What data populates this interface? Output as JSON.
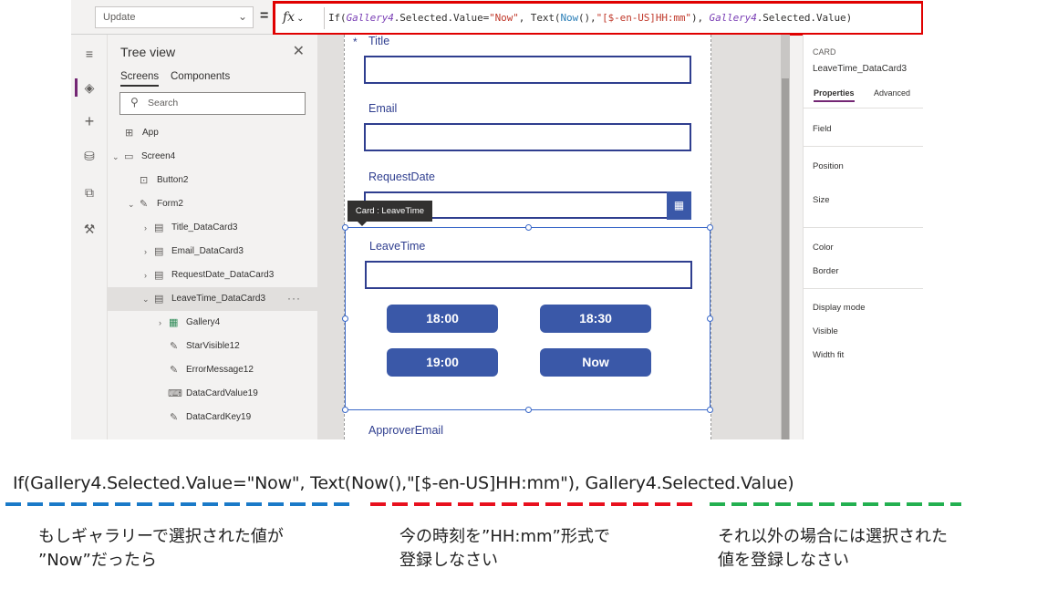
{
  "formula_bar": {
    "property": "Update",
    "fx_label": "fx",
    "formula_parts": [
      {
        "text": "If(",
        "style": "fn"
      },
      {
        "text": "Gallery4",
        "style": "id"
      },
      {
        "text": ".Selected.Value=",
        "style": "fn"
      },
      {
        "text": "\"Now\"",
        "style": "str"
      },
      {
        "text": ", Text(",
        "style": "fn"
      },
      {
        "text": "Now",
        "style": "kw"
      },
      {
        "text": "(),",
        "style": "fn"
      },
      {
        "text": "\"[$-en-US]HH:mm\"",
        "style": "str"
      },
      {
        "text": "), ",
        "style": "fn"
      },
      {
        "text": "Gallery4",
        "style": "id"
      },
      {
        "text": ".Selected.Value)",
        "style": "fn"
      }
    ]
  },
  "tree_view": {
    "title": "Tree view",
    "tabs": [
      "Screens",
      "Components"
    ],
    "search_placeholder": "Search",
    "nodes": [
      {
        "label": "App",
        "icon": "app-icon",
        "chevron": ""
      },
      {
        "label": "Screen4",
        "icon": "screen-icon",
        "chevron": "⌄"
      },
      {
        "label": "Button2",
        "icon": "button-icon",
        "chevron": ""
      },
      {
        "label": "Form2",
        "icon": "form-icon",
        "chevron": "⌄"
      },
      {
        "label": "Title_DataCard3",
        "icon": "card-icon",
        "chevron": "›"
      },
      {
        "label": "Email_DataCard3",
        "icon": "card-icon",
        "chevron": "›"
      },
      {
        "label": "RequestDate_DataCard3",
        "icon": "card-icon",
        "chevron": "›"
      },
      {
        "label": "LeaveTime_DataCard3",
        "icon": "card-icon",
        "chevron": "⌄",
        "selected": true
      },
      {
        "label": "Gallery4",
        "icon": "gallery-icon",
        "chevron": "›"
      },
      {
        "label": "StarVisible12",
        "icon": "edit-icon",
        "chevron": ""
      },
      {
        "label": "ErrorMessage12",
        "icon": "edit-icon",
        "chevron": ""
      },
      {
        "label": "DataCardValue19",
        "icon": "input-icon",
        "chevron": ""
      },
      {
        "label": "DataCardKey19",
        "icon": "edit-icon",
        "chevron": ""
      }
    ]
  },
  "canvas": {
    "required_mark": "*",
    "fields": {
      "title": "Title",
      "email": "Email",
      "request_date": "RequestDate",
      "leave_time": "LeaveTime",
      "approver_email": "ApproverEmail"
    },
    "card_tooltip": "Card : LeaveTime",
    "time_buttons": [
      "18:00",
      "18:30",
      "19:00",
      "Now"
    ]
  },
  "properties_panel": {
    "kind": "CARD",
    "name": "LeaveTime_DataCard3",
    "tabs": [
      "Properties",
      "Advanced"
    ],
    "rows": [
      "Field",
      "Position",
      "Size",
      "Color",
      "Border",
      "Display mode",
      "Visible",
      "Width fit"
    ]
  },
  "annotation": {
    "formula_text": "If(Gallery4.Selected.Value=\"Now\", Text(Now(),\"[$-en-US]HH:mm\"), Gallery4.Selected.Value)",
    "segment_colors": [
      "#1a7ac8",
      "#e8101e",
      "#23b050"
    ],
    "notes": [
      [
        "もしギャラリーで選択された値が",
        "”Now”だったら"
      ],
      [
        "今の時刻を”HH:mm”形式で",
        "登録しなさい"
      ],
      [
        "それ以外の場合には選択された",
        "値を登録しなさい"
      ]
    ]
  }
}
